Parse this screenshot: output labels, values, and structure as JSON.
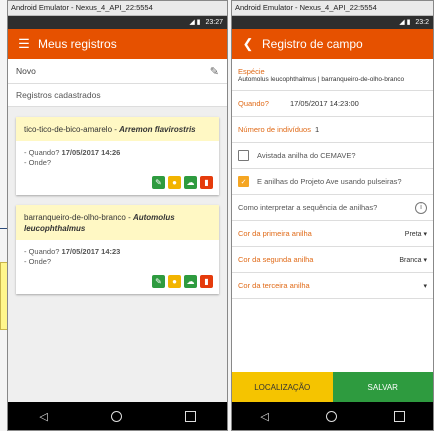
{
  "left": {
    "window_title": "Android Emulator - Nexus_4_API_22:5554",
    "status_time": "23:27",
    "app_title": "Meus registros",
    "novo_label": "Novo",
    "section_label": "Registros cadastrados",
    "cards": [
      {
        "common_name": "tico-tico-de-bico-amarelo",
        "species": "Arremon flavirostris",
        "quando_label": "- Quando?",
        "quando_value": "17/05/2017 14:26",
        "onde_label": "- Onde?"
      },
      {
        "common_name": "barranqueiro-de-olho-branco",
        "species": "Automolus leucophthalmus",
        "quando_label": "- Quando?",
        "quando_value": "17/05/2017 14:23",
        "onde_label": "- Onde?"
      }
    ]
  },
  "right": {
    "window_title": "Android Emulator - Nexus_4_API_22:5554",
    "status_time": "23:2",
    "app_title": "Registro de campo",
    "especie_label": "Espécie",
    "especie_value": "Automolus leucophthalmus | barranqueiro-de-olho-branco",
    "quando_label": "Quando?",
    "quando_value": "17/05/2017 14:23:00",
    "numero_label": "Número de indivíduos",
    "numero_value": "1",
    "cemave_label": "Avistada anilha do CEMAVE?",
    "projeto_label": "E anilhas do Projeto Ave usando pulseiras?",
    "interpretar_label": "Como interpretar a sequência de anilhas?",
    "cor1_label": "Cor da primeira anilha",
    "cor1_value": "Preta",
    "cor2_label": "Cor da segunda anilha",
    "cor2_value": "Branca",
    "cor3_label": "Cor da terceira anilha",
    "localizacao_label": "LOCALIZAÇÃO",
    "salvar_label": "SALVAR"
  },
  "colors": {
    "accent": "#e65100",
    "green": "#2e9b3f",
    "yellow": "#f5c400",
    "card_bg": "#fff8c4"
  }
}
